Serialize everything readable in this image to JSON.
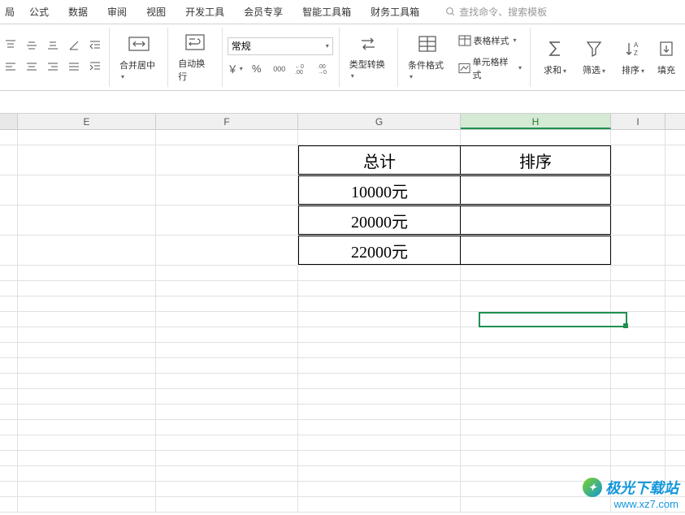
{
  "tabs": {
    "partial": "局",
    "t1": "公式",
    "t2": "数据",
    "t3": "审阅",
    "t4": "视图",
    "t5": "开发工具",
    "t6": "会员专享",
    "t7": "智能工具箱",
    "t8": "财务工具箱"
  },
  "search": {
    "placeholder": "查找命令、搜索模板"
  },
  "ribbon": {
    "merge": "合并居中",
    "wrap": "自动换行",
    "numfmt": "常规",
    "currency": "¥",
    "percent": "%",
    "comma": "000",
    "inc_dec": "←0.00",
    "dec_dec": ".00→",
    "type_conv": "类型转换",
    "cond_fmt": "条件格式",
    "table_style": "表格样式",
    "cell_style": "单元格样式",
    "sum": "求和",
    "filter": "筛选",
    "sort": "排序",
    "fill": "填充"
  },
  "columns": {
    "E": "E",
    "F": "F",
    "G": "G",
    "H": "H",
    "I": "I"
  },
  "data": {
    "g_header": "总计",
    "h_header": "排序",
    "g2": "10000元",
    "g3": "20000元",
    "g4": "22000元"
  },
  "watermark": {
    "name": "极光下载站",
    "url": "www.xz7.com"
  }
}
